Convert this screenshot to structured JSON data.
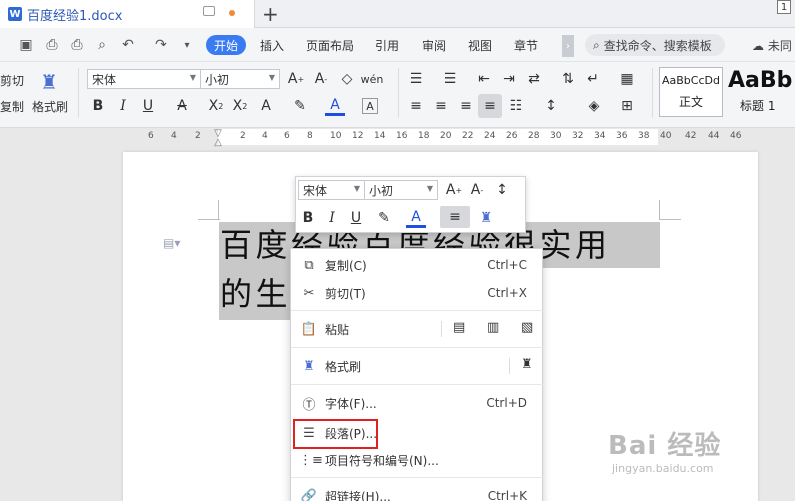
{
  "titlebar": {
    "doc_title": "百度经验1.docx",
    "plus": "+",
    "badge": "1"
  },
  "menu": {
    "items": [
      "开始",
      "插入",
      "页面布局",
      "引用",
      "审阅",
      "视图",
      "章节"
    ],
    "search_placeholder": "查找命令、搜索模板",
    "cloud_label": "未同"
  },
  "ribbon": {
    "cut": "剪切",
    "copy": "复制",
    "format_painter": "格式刷",
    "font_name": "宋体",
    "font_size": "小初",
    "style_normal_sample": "AaBbCcDd",
    "style_normal_label": "正文",
    "style_h1_sample": "AaBb",
    "style_h1_label": "标题 1"
  },
  "ruler": {
    "ticks": [
      "6",
      "4",
      "2",
      "2",
      "4",
      "6",
      "8",
      "10",
      "12",
      "14",
      "16",
      "18",
      "20",
      "22",
      "24",
      "26",
      "28",
      "30",
      "32",
      "34",
      "36",
      "38",
      "40",
      "42",
      "44",
      "46"
    ]
  },
  "document": {
    "line1": "百度经验百度经验很实用",
    "line2": "的生"
  },
  "mini_toolbar": {
    "font_name": "宋体",
    "font_size": "小初"
  },
  "context_menu": {
    "copy": "复制(C)",
    "copy_sc": "Ctrl+C",
    "cut": "剪切(T)",
    "cut_sc": "Ctrl+X",
    "paste": "粘贴",
    "format_painter": "格式刷",
    "font": "字体(F)...",
    "font_sc": "Ctrl+D",
    "paragraph": "段落(P)...",
    "bullets": "项目符号和编号(N)...",
    "hyperlink": "超链接(H)...",
    "hyperlink_sc": "Ctrl+K"
  },
  "watermark": {
    "brand": "Bai 经验",
    "url": "jingyan.baidu.com"
  },
  "colors": {
    "accent": "#3a7bf2",
    "highlight_border": "#e0211d",
    "font_color_bar": "#1f4fe0"
  }
}
